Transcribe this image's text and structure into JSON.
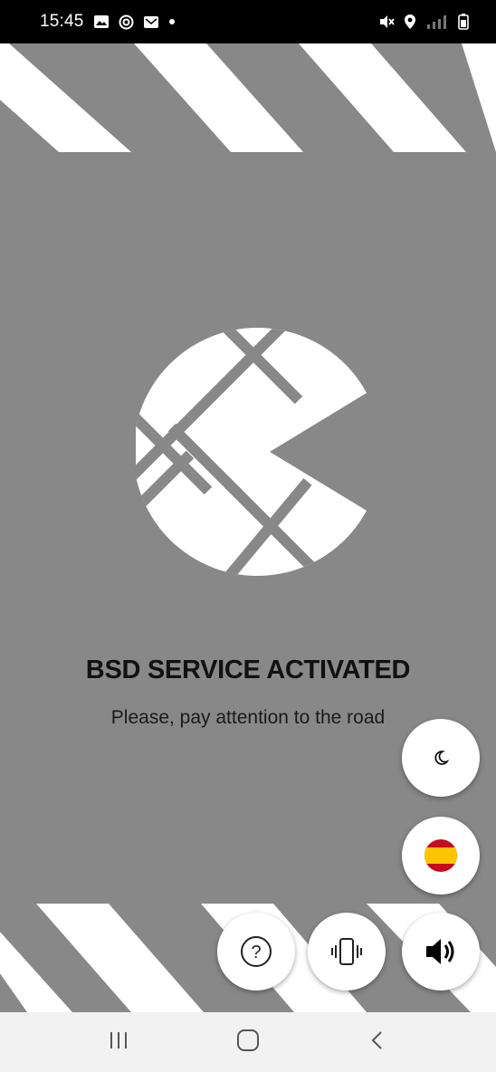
{
  "status_bar": {
    "time": "15:45",
    "left_icons": [
      "gallery-icon",
      "at-sign-icon",
      "mail-icon",
      "dot-icon"
    ],
    "right_icons": [
      "mute-icon",
      "location-icon",
      "signal-icon",
      "battery-icon"
    ]
  },
  "main": {
    "headline": "BSD SERVICE ACTIVATED",
    "subline": "Please, pay attention to the road"
  },
  "fabs": {
    "theme": {
      "icon": "moon-icon"
    },
    "language": {
      "icon": "spain-flag-icon"
    },
    "help": {
      "icon": "help-icon"
    },
    "vibration": {
      "icon": "vibrate-icon"
    },
    "sound": {
      "icon": "speaker-icon"
    }
  },
  "nav": {
    "recent": "recents-icon",
    "home": "home-icon",
    "back": "back-icon"
  },
  "colors": {
    "background": "#888888",
    "stripe": "#ffffff",
    "text": "#111111",
    "flag_red": "#c60b1e",
    "flag_yellow": "#ffc400"
  }
}
